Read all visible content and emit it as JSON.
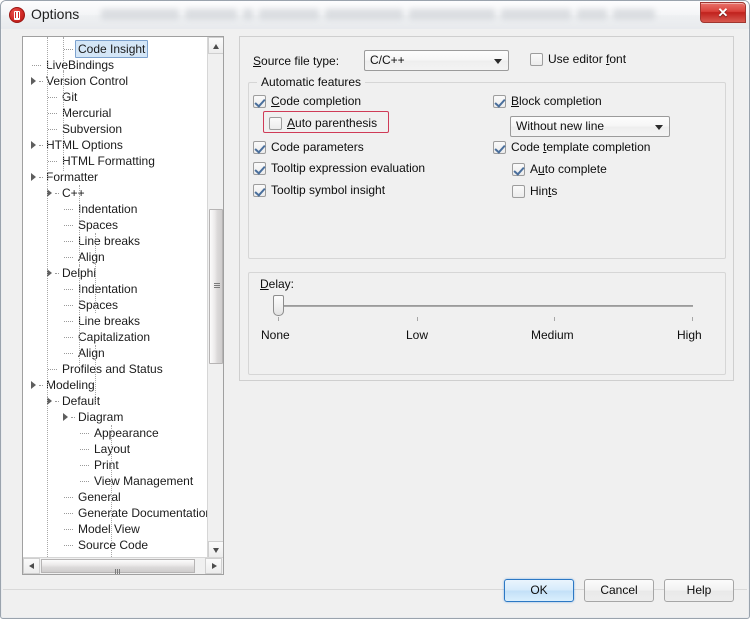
{
  "window": {
    "title": "Options",
    "app_icon": "options-app-icon",
    "close_label": "✕"
  },
  "tree": {
    "name": "options-category-tree",
    "selected": "Code Insight",
    "nodes": [
      {
        "label": "Code Insight",
        "depth": 3,
        "state": "leaf",
        "selected": true
      },
      {
        "label": "LiveBindings",
        "depth": 1,
        "state": "leaf",
        "selected": false
      },
      {
        "label": "Version Control",
        "depth": 1,
        "state": "expanded",
        "selected": false
      },
      {
        "label": "Git",
        "depth": 2,
        "state": "leaf",
        "selected": false
      },
      {
        "label": "Mercurial",
        "depth": 2,
        "state": "leaf",
        "selected": false
      },
      {
        "label": "Subversion",
        "depth": 2,
        "state": "leaf",
        "selected": false
      },
      {
        "label": "HTML Options",
        "depth": 1,
        "state": "expanded",
        "selected": false
      },
      {
        "label": "HTML Formatting",
        "depth": 2,
        "state": "leaf",
        "selected": false
      },
      {
        "label": "Formatter",
        "depth": 1,
        "state": "expanded",
        "selected": false
      },
      {
        "label": "C++",
        "depth": 2,
        "state": "expanded",
        "selected": false
      },
      {
        "label": "Indentation",
        "depth": 3,
        "state": "leaf",
        "selected": false
      },
      {
        "label": "Spaces",
        "depth": 3,
        "state": "leaf",
        "selected": false
      },
      {
        "label": "Line breaks",
        "depth": 3,
        "state": "leaf",
        "selected": false
      },
      {
        "label": "Align",
        "depth": 3,
        "state": "leaf",
        "selected": false
      },
      {
        "label": "Delphi",
        "depth": 2,
        "state": "expanded",
        "selected": false
      },
      {
        "label": "Indentation",
        "depth": 3,
        "state": "leaf",
        "selected": false
      },
      {
        "label": "Spaces",
        "depth": 3,
        "state": "leaf",
        "selected": false
      },
      {
        "label": "Line breaks",
        "depth": 3,
        "state": "leaf",
        "selected": false
      },
      {
        "label": "Capitalization",
        "depth": 3,
        "state": "leaf",
        "selected": false
      },
      {
        "label": "Align",
        "depth": 3,
        "state": "leaf",
        "selected": false
      },
      {
        "label": "Profiles and Status",
        "depth": 2,
        "state": "leaf",
        "selected": false
      },
      {
        "label": "Modeling",
        "depth": 1,
        "state": "expanded",
        "selected": false
      },
      {
        "label": "Default",
        "depth": 2,
        "state": "expanded",
        "selected": false
      },
      {
        "label": "Diagram",
        "depth": 3,
        "state": "expanded",
        "selected": false
      },
      {
        "label": "Appearance",
        "depth": 4,
        "state": "leaf",
        "selected": false
      },
      {
        "label": "Layout",
        "depth": 4,
        "state": "leaf",
        "selected": false
      },
      {
        "label": "Print",
        "depth": 4,
        "state": "leaf",
        "selected": false
      },
      {
        "label": "View Management",
        "depth": 4,
        "state": "leaf",
        "selected": false
      },
      {
        "label": "General",
        "depth": 3,
        "state": "leaf",
        "selected": false
      },
      {
        "label": "Generate Documentation",
        "depth": 3,
        "state": "leaf",
        "selected": false
      },
      {
        "label": "Model View",
        "depth": 3,
        "state": "leaf",
        "selected": false
      },
      {
        "label": "Source Code",
        "depth": 3,
        "state": "leaf",
        "selected": false
      }
    ]
  },
  "panel": {
    "source_file_type_label": "Source file type:",
    "source_file_type_value": "C/C++",
    "use_editor_font": {
      "label": "Use editor font",
      "checked": false
    },
    "automatic_features_caption": "Automatic features",
    "left_column": [
      {
        "label": "Code completion",
        "checked": true,
        "name": "code-completion"
      },
      {
        "label": "Auto parenthesis",
        "checked": false,
        "name": "auto-parenthesis",
        "indented": true,
        "highlighted": true
      },
      {
        "label": "Code parameters",
        "checked": true,
        "name": "code-parameters"
      },
      {
        "label": "Tooltip expression evaluation",
        "checked": true,
        "name": "tooltip-expression-evaluation"
      },
      {
        "label": "Tooltip symbol insight",
        "checked": true,
        "name": "tooltip-symbol-insight"
      }
    ],
    "right_column": [
      {
        "label": "Block completion",
        "checked": true,
        "name": "block-completion"
      },
      {
        "label": "Code template completion",
        "checked": true,
        "name": "code-template-completion"
      },
      {
        "label": "Auto complete",
        "checked": true,
        "name": "auto-complete",
        "indented": true
      },
      {
        "label": "Hints",
        "checked": false,
        "name": "hints",
        "indented": true
      }
    ],
    "block_completion_mode": "Without new line",
    "delay": {
      "label": "Delay:",
      "value": 0,
      "min": 0,
      "max": 3,
      "ticks": [
        "None",
        "Low",
        "Medium",
        "High"
      ]
    }
  },
  "buttons": {
    "ok": "OK",
    "cancel": "Cancel",
    "help": "Help"
  },
  "colors": {
    "accent": "#2c78c4",
    "highlight": "#cf3b57",
    "selection": "#d4e6f7",
    "close": "#c0211c"
  }
}
